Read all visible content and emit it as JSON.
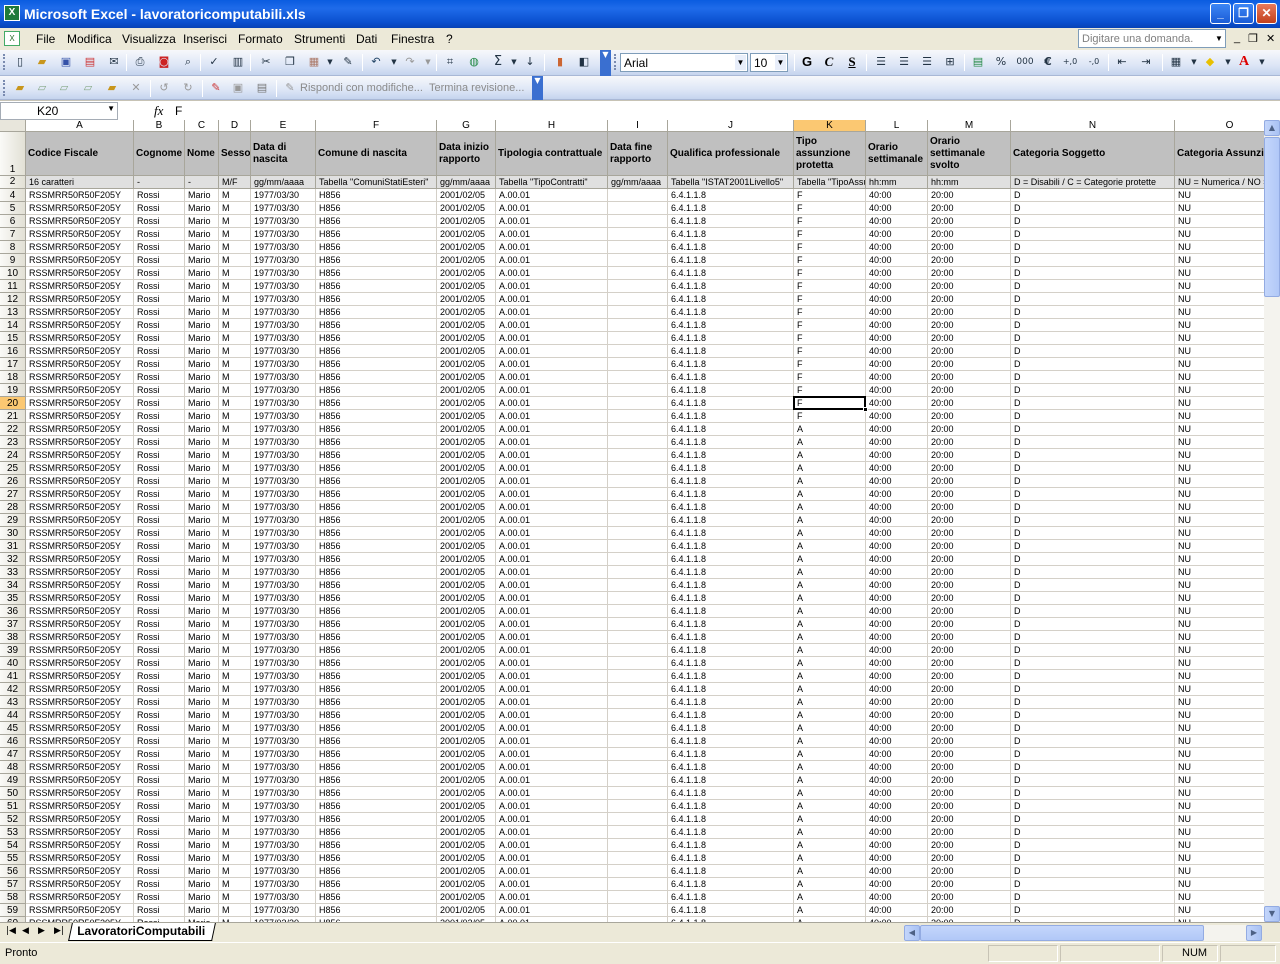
{
  "window": {
    "title": "Microsoft Excel - lavoratoricomputabili.xls"
  },
  "menu": {
    "items": [
      "File",
      "Modifica",
      "Visualizza",
      "Inserisci",
      "Formato",
      "Strumenti",
      "Dati",
      "Finestra",
      "?"
    ],
    "ask_placeholder": "Digitare una domanda."
  },
  "format_toolbar": {
    "font": "Arial",
    "size": "10",
    "bold": "G",
    "italic": "C",
    "underline": "S"
  },
  "review_toolbar": {
    "reply": "Rispondi con modifiche...",
    "end_review": "Termina revisione..."
  },
  "formula_bar": {
    "name_box": "K20",
    "fx": "fx",
    "value": "F"
  },
  "columns": [
    "A",
    "B",
    "C",
    "D",
    "E",
    "F",
    "G",
    "H",
    "I",
    "J",
    "K",
    "L",
    "M",
    "N",
    "O"
  ],
  "selected_column": "K",
  "header_row": {
    "number": "1",
    "cells": [
      "Codice Fiscale",
      "Cognome",
      "Nome",
      "Sesso",
      "Data di nascita",
      "Comune di nascita",
      "Data inizio rapporto",
      "Tipologia contrattuale",
      "Data fine rapporto",
      "Qualifica professionale",
      "Tipo assunzione protetta",
      "Orario settimanale",
      "Orario settimanale svolto",
      "Categoria Soggetto",
      "Categoria Assunzione"
    ]
  },
  "format_row": {
    "number": "2",
    "cells": [
      "16 caratteri",
      "-",
      "-",
      "M/F",
      "gg/mm/aaaa",
      "Tabella \"ComuniStatiEsteri\"",
      "gg/mm/aaaa",
      "Tabella \"TipoContratti\"",
      "gg/mm/aaaa",
      "Tabella \"ISTAT2001Livello5\"",
      "Tabella \"TipoAssunzioneProtetta\"",
      "hh:mm",
      "hh:mm",
      "D = Disabili / C = Categorie protette",
      "NU = Numerica / NO = Nominativa"
    ]
  },
  "data_rows": {
    "first_row_number": 4,
    "last_row_number": 60,
    "row_template": [
      "RSSMRR50R50F205Y",
      "Rossi",
      "Mario",
      "M",
      "1977/03/30",
      "H856",
      "2001/02/05",
      "A.00.01",
      "",
      "6.4.1.1.8",
      "F",
      "40:00",
      "20:00",
      "D",
      "NU"
    ],
    "tipo_assunzione_f_until_row": 21,
    "tipo_assunzione_after": "A"
  },
  "active_cell": {
    "column": "K",
    "row": 20
  },
  "sheet_tab": "LavoratoriComputabili",
  "status": {
    "text": "Pronto",
    "num": "NUM"
  }
}
